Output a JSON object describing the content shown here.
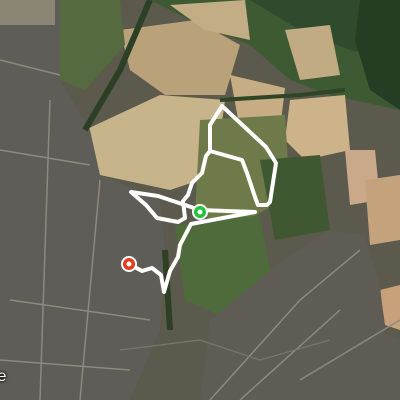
{
  "map": {
    "view": "satellite",
    "route_color": "#ffffff",
    "start_marker": {
      "kind": "start",
      "color": "#22c33a",
      "icon": "start-pin-icon"
    },
    "end_marker": {
      "kind": "end",
      "color": "#e53a1e",
      "icon": "end-pin-icon"
    },
    "attribution": "le"
  }
}
